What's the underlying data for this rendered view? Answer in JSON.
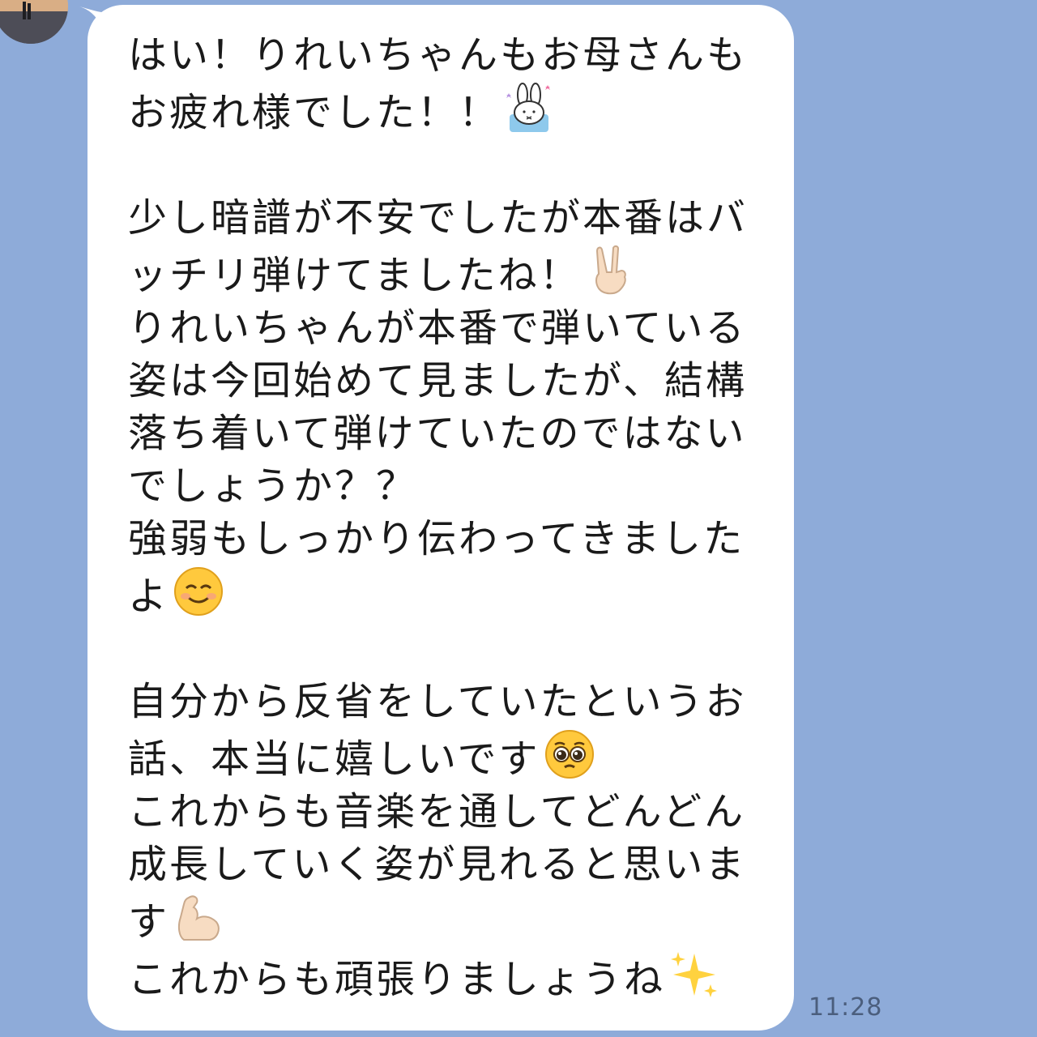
{
  "message": {
    "lines": [
      "はい！りれいちゃんもお母さんも",
      "お疲れ様でした！！",
      "",
      "少し暗譜が不安でしたが本番はバ",
      "ッチリ弾けてましたね！",
      "りれいちゃんが本番で弾いている",
      "姿は今回始めて見ましたが、結構",
      "落ち着いて弾けていたのではない",
      "でしょうか？？",
      "強弱もしっかり伝わってきました",
      "よ",
      "",
      "自分から反省をしていたというお",
      "話、本当に嬉しいです",
      "これからも音楽を通してどんどん",
      "成長していく姿が見れると思いま",
      "す",
      "これからも頑張りましょうね"
    ],
    "emojis": {
      "line_2": "bunny-sticker-icon",
      "line_5": "victory-hand-icon",
      "line_11": "smiling-face-icon",
      "line_14": "pleading-face-icon",
      "line_17": "flexed-biceps-icon",
      "line_18": "sparkles-icon"
    }
  },
  "timestamp": "11:28",
  "colors": {
    "background": "#8eabd9",
    "bubble": "#ffffff",
    "text": "#1a1a1a",
    "timestamp": "#4b5e7d"
  }
}
